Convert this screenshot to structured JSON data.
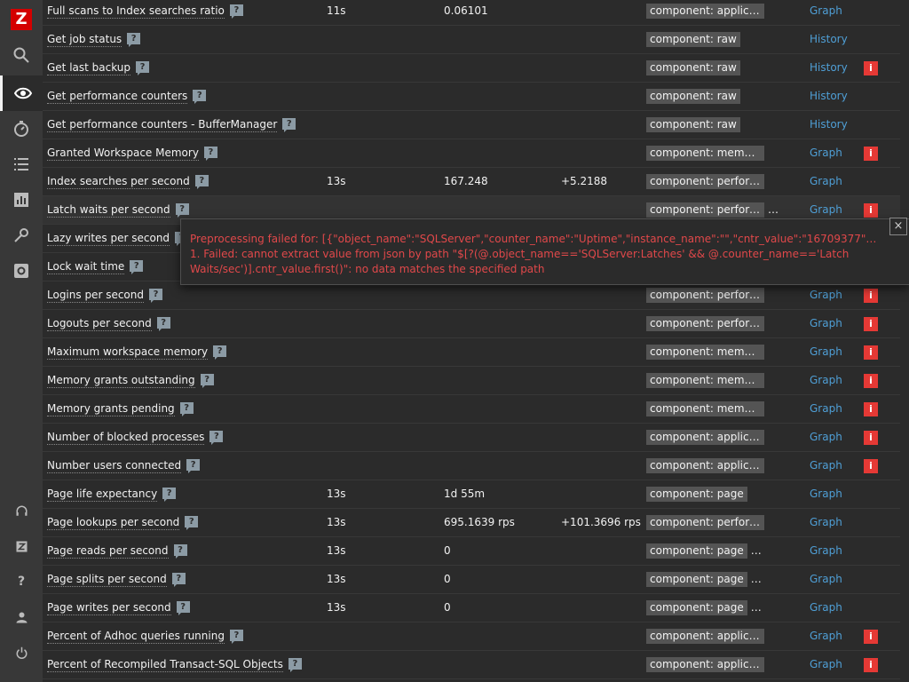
{
  "app": {
    "logo_text": "Z"
  },
  "sidebar": {
    "items": [
      {
        "name": "search-icon"
      },
      {
        "name": "eye-icon",
        "active": true
      },
      {
        "name": "timer-icon"
      },
      {
        "name": "list-icon"
      },
      {
        "name": "chart-icon"
      },
      {
        "name": "wrench-icon"
      },
      {
        "name": "gear-icon"
      },
      {
        "name": "headset-icon"
      },
      {
        "name": "z-icon",
        "glyph": "Z"
      },
      {
        "name": "help-icon",
        "glyph": "?"
      },
      {
        "name": "user-icon"
      },
      {
        "name": "power-icon"
      }
    ]
  },
  "rows": [
    {
      "name": "Full scans to Index searches ratio",
      "interval": "11s",
      "last": "0.06101",
      "change": "",
      "tag": "component: application",
      "more": "",
      "action": "Graph",
      "info": false
    },
    {
      "name": "Get job status",
      "interval": "",
      "last": "",
      "change": "",
      "tag": "component: raw",
      "more": "",
      "action": "History",
      "info": false
    },
    {
      "name": "Get last backup",
      "interval": "",
      "last": "",
      "change": "",
      "tag": "component: raw",
      "more": "",
      "action": "History",
      "info": true
    },
    {
      "name": "Get performance counters",
      "interval": "",
      "last": "",
      "change": "",
      "tag": "component: raw",
      "more": "",
      "action": "History",
      "info": false
    },
    {
      "name": "Get performance counters - BufferManager",
      "interval": "",
      "last": "",
      "change": "",
      "tag": "component: raw",
      "more": "",
      "action": "History",
      "info": false
    },
    {
      "name": "Granted Workspace Memory",
      "interval": "",
      "last": "",
      "change": "",
      "tag": "component: memory",
      "more": "",
      "action": "Graph",
      "info": true
    },
    {
      "name": "Index searches per second",
      "interval": "13s",
      "last": "167.248",
      "change": "+5.2188",
      "tag": "component: performa…",
      "more": "",
      "action": "Graph",
      "info": false
    },
    {
      "name": "Latch waits per second",
      "interval": "",
      "last": "",
      "change": "",
      "tag": "component: performa…",
      "more": "…",
      "action": "Graph",
      "info": true,
      "highlight": true
    },
    {
      "name": "Lazy writes per second",
      "interval": "",
      "last": "",
      "change": "",
      "tag": "",
      "more": "",
      "action": "",
      "info": false
    },
    {
      "name": "Lock wait time",
      "interval": "",
      "last": "",
      "change": "",
      "tag": "",
      "more": "",
      "action": "",
      "info": false
    },
    {
      "name": "Logins per second",
      "interval": "",
      "last": "",
      "change": "",
      "tag": "component: performa…",
      "more": "",
      "action": "Graph",
      "info": true
    },
    {
      "name": "Logouts per second",
      "interval": "",
      "last": "",
      "change": "",
      "tag": "component: performa…",
      "more": "",
      "action": "Graph",
      "info": true
    },
    {
      "name": "Maximum workspace memory",
      "interval": "",
      "last": "",
      "change": "",
      "tag": "component: memory",
      "more": "",
      "action": "Graph",
      "info": true
    },
    {
      "name": "Memory grants outstanding",
      "interval": "",
      "last": "",
      "change": "",
      "tag": "component: memory",
      "more": "",
      "action": "Graph",
      "info": true
    },
    {
      "name": "Memory grants pending",
      "interval": "",
      "last": "",
      "change": "",
      "tag": "component: memory",
      "more": "",
      "action": "Graph",
      "info": true
    },
    {
      "name": "Number of blocked processes",
      "interval": "",
      "last": "",
      "change": "",
      "tag": "component: application",
      "more": "",
      "action": "Graph",
      "info": true
    },
    {
      "name": "Number users connected",
      "interval": "",
      "last": "",
      "change": "",
      "tag": "component: application",
      "more": "",
      "action": "Graph",
      "info": true
    },
    {
      "name": "Page life expectancy",
      "interval": "13s",
      "last": "1d 55m",
      "change": "",
      "tag": "component: page",
      "more": "",
      "action": "Graph",
      "info": false
    },
    {
      "name": "Page lookups per second",
      "interval": "13s",
      "last": "695.1639 rps",
      "change": "+101.3696 rps",
      "tag": "component: performa…",
      "more": "",
      "action": "Graph",
      "info": false
    },
    {
      "name": "Page reads per second",
      "interval": "13s",
      "last": "0",
      "change": "",
      "tag": "component: page",
      "more": "…",
      "action": "Graph",
      "info": false
    },
    {
      "name": "Page splits per second",
      "interval": "13s",
      "last": "0",
      "change": "",
      "tag": "component: page",
      "more": "…",
      "action": "Graph",
      "info": false
    },
    {
      "name": "Page writes per second",
      "interval": "13s",
      "last": "0",
      "change": "",
      "tag": "component: page",
      "more": "…",
      "action": "Graph",
      "info": false
    },
    {
      "name": "Percent of Adhoc queries running",
      "interval": "",
      "last": "",
      "change": "",
      "tag": "component: application",
      "more": "",
      "action": "Graph",
      "info": true
    },
    {
      "name": "Percent of Recompiled Transact-SQL Objects",
      "interval": "",
      "last": "",
      "change": "",
      "tag": "component: application",
      "more": "",
      "action": "Graph",
      "info": true
    }
  ],
  "q_mark": "?",
  "info_glyph": "i",
  "popup": {
    "line1": "Preprocessing failed for: [{\"object_name\":\"SQLServer\",\"counter_name\":\"Uptime\",\"instance_name\":\"\",\"cntr_value\":\"16709377\"},{...",
    "line2": "1. Failed: cannot extract value from json by path \"$[?(@.object_name=='SQLServer:Latches' && @.counter_name=='Latch",
    "line3": "Waits/sec')].cntr_value.first()\": no data matches the specified path",
    "close": "×"
  },
  "colors": {
    "background": "#2b2b2b",
    "sidebar": "#383838",
    "link": "#4f9fd6",
    "error": "#e0484a",
    "info_badge": "#e53935",
    "tag": "#545454"
  }
}
